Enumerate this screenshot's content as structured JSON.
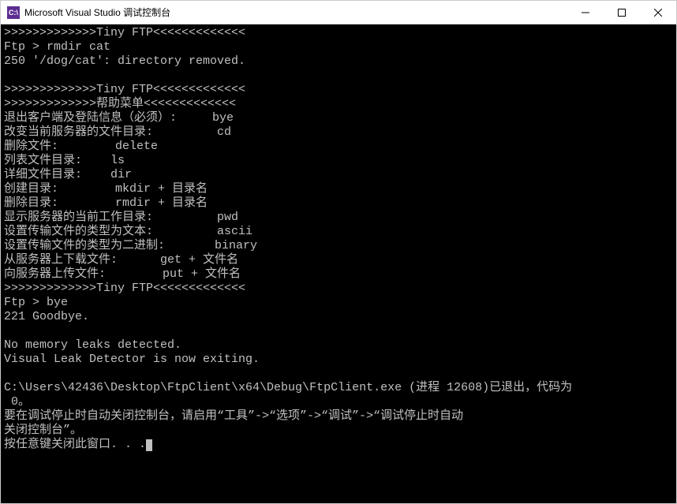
{
  "titlebar": {
    "icon_label": "C:\\",
    "title": "Microsoft Visual Studio 调试控制台"
  },
  "console": {
    "lines": [
      ">>>>>>>>>>>>>Tiny FTP<<<<<<<<<<<<<",
      "Ftp > rmdir cat",
      "250 '/dog/cat': directory removed.",
      "",
      ">>>>>>>>>>>>>Tiny FTP<<<<<<<<<<<<<",
      ">>>>>>>>>>>>>帮助菜单<<<<<<<<<<<<<",
      "退出客户端及登陆信息（必须）:     bye",
      "改变当前服务器的文件目录:         cd",
      "删除文件:        delete",
      "列表文件目录:    ls",
      "详细文件目录:    dir",
      "创建目录:        mkdir + 目录名",
      "删除目录:        rmdir + 目录名",
      "显示服务器的当前工作目录:         pwd",
      "设置传输文件的类型为文本:         ascii",
      "设置传输文件的类型为二进制:       binary",
      "从服务器上下载文件:      get + 文件名",
      "向服务器上传文件:        put + 文件名",
      ">>>>>>>>>>>>>Tiny FTP<<<<<<<<<<<<<",
      "Ftp > bye",
      "221 Goodbye.",
      "",
      "No memory leaks detected.",
      "Visual Leak Detector is now exiting.",
      "",
      "C:\\Users\\42436\\Desktop\\FtpClient\\x64\\Debug\\FtpClient.exe (进程 12608)已退出，代码为",
      " 0。",
      "要在调试停止时自动关闭控制台，请启用“工具”->“选项”->“调试”->“调试停止时自动",
      "关闭控制台”。"
    ],
    "last_line": "按任意键关闭此窗口. . ."
  }
}
